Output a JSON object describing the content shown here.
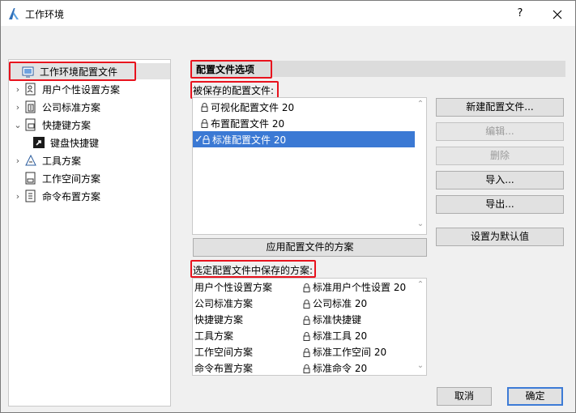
{
  "window": {
    "title": "工作环境",
    "help_label": "?",
    "close_label": "✕"
  },
  "tree": {
    "items": [
      {
        "label": "工作环境配置文件",
        "icon": "profile-icon",
        "selected": true
      },
      {
        "label": "用户个性设置方案",
        "icon": "user-prefs-icon"
      },
      {
        "label": "公司标准方案",
        "icon": "company-standards-icon"
      },
      {
        "label": "快捷键方案",
        "icon": "shortcuts-icon",
        "expanded": true
      },
      {
        "label": "键盘快捷键",
        "icon": "keyboard-shortcut-icon",
        "child": true
      },
      {
        "label": "工具方案",
        "icon": "tools-icon"
      },
      {
        "label": "工作空间方案",
        "icon": "workspace-icon"
      },
      {
        "label": "命令布置方案",
        "icon": "command-layout-icon"
      }
    ]
  },
  "section": {
    "header": "配置文件选项",
    "saved_profiles_label": "被保存的配置文件:",
    "schemes_label": "选定配置文件中保存的方案:"
  },
  "profiles": [
    {
      "name": "可视化配置文件 20",
      "selected": false
    },
    {
      "name": "布置配置文件 20",
      "selected": false
    },
    {
      "name": "标准配置文件 20",
      "selected": true
    }
  ],
  "buttons": {
    "new_profile": "新建配置文件...",
    "edit": "编辑...",
    "delete": "删除",
    "import": "导入...",
    "export": "导出...",
    "set_default": "设置为默认值",
    "apply_schemes": "应用配置文件的方案",
    "cancel": "取消",
    "ok": "确定"
  },
  "schemes": [
    {
      "type": "用户个性设置方案",
      "value": "标准用户个性设置 20"
    },
    {
      "type": "公司标准方案",
      "value": "公司标准 20"
    },
    {
      "type": "快捷键方案",
      "value": "标准快捷键"
    },
    {
      "type": "工具方案",
      "value": "标准工具 20"
    },
    {
      "type": "工作空间方案",
      "value": "标准工作空间 20"
    },
    {
      "type": "命令布置方案",
      "value": "标准命令 20"
    }
  ],
  "colors": {
    "highlight": "#e8121d",
    "selection": "#3b79d4",
    "default_button_border": "#3d7bd6"
  }
}
